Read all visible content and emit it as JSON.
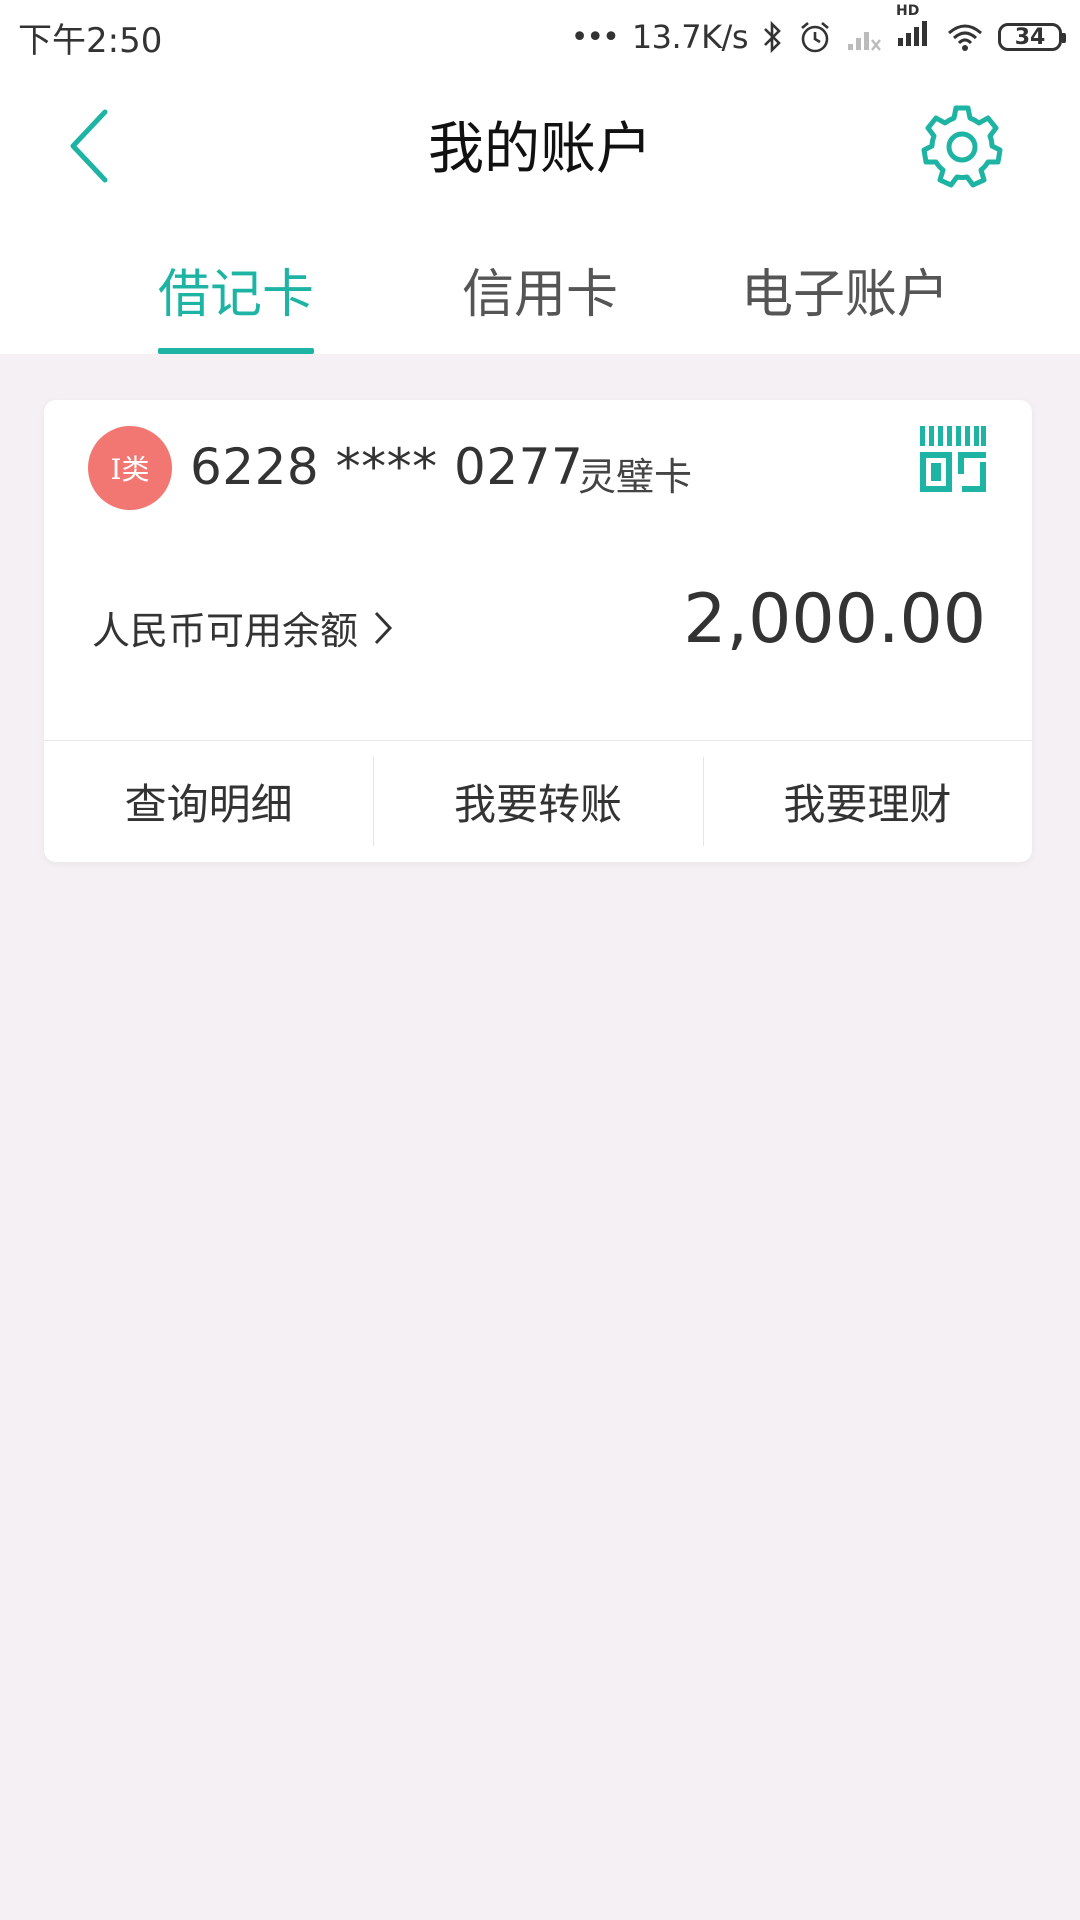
{
  "status_bar": {
    "time": "下午2:50",
    "net_speed": "13.7K/s",
    "hd_label": "HD",
    "battery": "34"
  },
  "navbar": {
    "title": "我的账户"
  },
  "tabs": [
    {
      "label": "借记卡",
      "active": true
    },
    {
      "label": "信用卡",
      "active": false
    },
    {
      "label": "电子账户",
      "active": false
    }
  ],
  "account_card": {
    "badge": "I类",
    "card_number": "6228 **** 0277",
    "card_type": "灵璧卡",
    "balance_label": "人民币可用余额",
    "balance": "2,000.00",
    "actions": [
      "查询明细",
      "我要转账",
      "我要理财"
    ]
  },
  "colors": {
    "accent": "#1db4a4",
    "badge": "#f27672",
    "background": "#f4f0f4"
  }
}
